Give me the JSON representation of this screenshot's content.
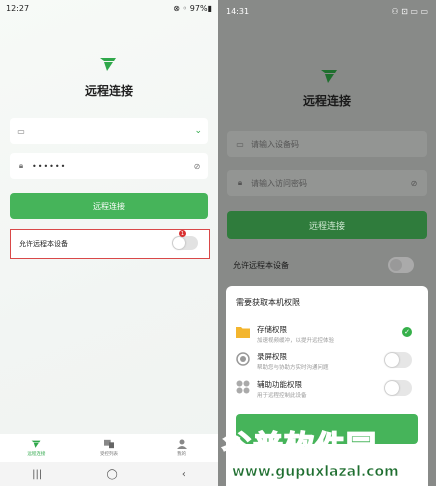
{
  "left": {
    "status": {
      "time": "12:27",
      "right": "⊗ ◦ 97%▮"
    },
    "title": "远程连接",
    "device_value": "",
    "password_value": "••••••",
    "connect_label": "远程连接",
    "allow_label": "允许远程本设备",
    "badge": "1",
    "tabs": [
      {
        "label": "远程连接"
      },
      {
        "label": "受控列表"
      },
      {
        "label": "我的"
      }
    ],
    "nav": [
      "|||",
      "◯",
      "‹"
    ]
  },
  "right": {
    "status": {
      "time": "14:31",
      "right": "⚇ ⊡ ▭ ▭"
    },
    "title": "远程连接",
    "device_placeholder": "请输入设备码",
    "password_placeholder": "请输入访问密码",
    "connect_label": "远程连接",
    "allow_label": "允许远程本设备",
    "sheet": {
      "title": "需要获取本机权限",
      "perms": [
        {
          "name": "存储权限",
          "desc": "加速视频缓冲，以提升远控体验",
          "state": "granted"
        },
        {
          "name": "录屏权限",
          "desc": "帮助您与协助方实时沟通问题",
          "state": "off"
        },
        {
          "name": "辅助功能权限",
          "desc": "用于远程控制此设备",
          "state": "off"
        }
      ]
    }
  },
  "watermark": {
    "line1": "谷普软件园",
    "line2": "www.gupuxlazal.com"
  },
  "colors": {
    "brand": "#2fa84a",
    "button": "#46b45a",
    "highlight": "#d94848"
  }
}
